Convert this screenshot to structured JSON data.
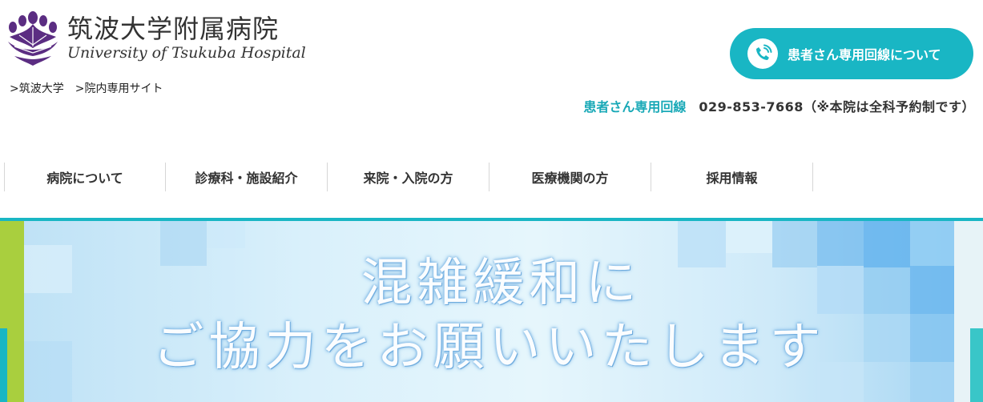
{
  "header": {
    "logo": {
      "name_ja": "筑波大学附属病院",
      "name_en": "University of Tsukuba Hospital",
      "mark_color": "#5b2d82"
    },
    "sublinks": [
      {
        "label": ">筑波大学"
      },
      {
        "label": ">院内専用サイト"
      }
    ],
    "cta": {
      "label": "患者さん専用回線について",
      "icon": "phone-icon",
      "color": "#19b6c4"
    },
    "phone": {
      "label": "患者さん専用回線",
      "number": "029-853-7668（※本院は全科予約制です）"
    }
  },
  "nav": {
    "items": [
      {
        "label": "病院について"
      },
      {
        "label": "診療科・施設紹介"
      },
      {
        "label": "来院・入院の方"
      },
      {
        "label": "医療機関の方"
      },
      {
        "label": "採用情報"
      }
    ],
    "accent_color": "#19b6c4"
  },
  "hero": {
    "line1": "混雑緩和に",
    "line2": "ご協力をお願いいたします",
    "left_accent_color": "#a9cf3e"
  }
}
